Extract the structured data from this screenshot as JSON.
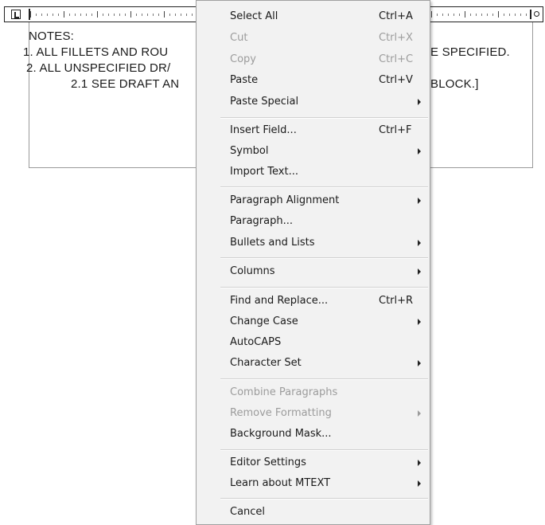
{
  "notes": {
    "line1": "NOTES:",
    "line2": "1. ALL FILLETS AND ROU",
    "line3": "2. ALL UNSPECIFIED DR/",
    "line4": "2.1 SEE DRAFT AN",
    "line2_right": "E SPECIFIED.",
    "line4_right": "BLOCK.]"
  },
  "menu": {
    "select_all": {
      "label": "Select All",
      "shortcut": "Ctrl+A"
    },
    "cut": {
      "label": "Cut",
      "shortcut": "Ctrl+X",
      "disabled": true
    },
    "copy": {
      "label": "Copy",
      "shortcut": "Ctrl+C",
      "disabled": true
    },
    "paste": {
      "label": "Paste",
      "shortcut": "Ctrl+V"
    },
    "paste_special": {
      "label": "Paste Special",
      "submenu": true
    },
    "insert_field": {
      "label": "Insert Field...",
      "shortcut": "Ctrl+F"
    },
    "symbol": {
      "label": "Symbol",
      "submenu": true
    },
    "import_text": {
      "label": "Import Text..."
    },
    "paragraph_alignment": {
      "label": "Paragraph Alignment",
      "submenu": true
    },
    "paragraph": {
      "label": "Paragraph..."
    },
    "bullets_and_lists": {
      "label": "Bullets and Lists",
      "submenu": true
    },
    "columns": {
      "label": "Columns",
      "submenu": true
    },
    "find_and_replace": {
      "label": "Find and Replace...",
      "shortcut": "Ctrl+R"
    },
    "change_case": {
      "label": "Change Case",
      "submenu": true
    },
    "autocaps": {
      "label": "AutoCAPS"
    },
    "character_set": {
      "label": "Character Set",
      "submenu": true
    },
    "combine_paragraphs": {
      "label": "Combine Paragraphs",
      "disabled": true
    },
    "remove_formatting": {
      "label": "Remove Formatting",
      "submenu": true,
      "disabled": true
    },
    "background_mask": {
      "label": "Background Mask..."
    },
    "editor_settings": {
      "label": "Editor Settings",
      "submenu": true
    },
    "learn_about_mtext": {
      "label": "Learn about MTEXT",
      "submenu": true
    },
    "cancel": {
      "label": "Cancel"
    }
  },
  "icons": {
    "ruler_corner": "tab-stop-icon",
    "submenu": "chevron-right-icon"
  }
}
